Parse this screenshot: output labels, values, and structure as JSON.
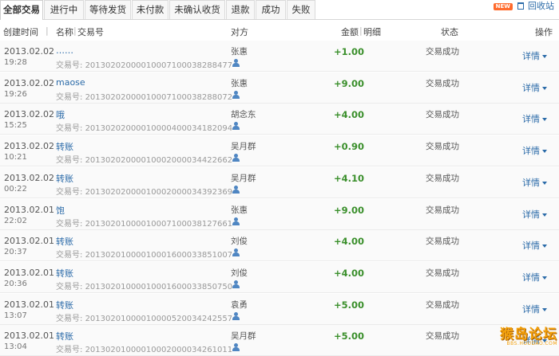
{
  "tabs": [
    {
      "label": "全部交易",
      "active": true
    },
    {
      "label": "进行中",
      "active": false
    },
    {
      "label": "等待发货",
      "active": false
    },
    {
      "label": "未付款",
      "active": false
    },
    {
      "label": "未确认收货",
      "active": false
    },
    {
      "label": "退款",
      "active": false
    },
    {
      "label": "成功",
      "active": false
    },
    {
      "label": "失败",
      "active": false
    }
  ],
  "recycle": {
    "badge": "NEW",
    "label": "回收站",
    "icon": "trash-icon"
  },
  "header": {
    "created": "创建时间",
    "name": "名称",
    "txid": "交易号",
    "party": "对方",
    "amount": "金额",
    "detail_col": "明细",
    "status": "状态",
    "action": "操作"
  },
  "txid_prefix": "交易号:",
  "rows": [
    {
      "date": "2013.02.02",
      "time": "19:28",
      "name": "……",
      "txid": "20130202000010007100038288477",
      "party": "张惠",
      "amount": "+1.00",
      "status": "交易成功",
      "detail": "详情"
    },
    {
      "date": "2013.02.02",
      "time": "19:26",
      "name": "maose",
      "txid": "20130202000010007100038288072",
      "party": "张惠",
      "amount": "+9.00",
      "status": "交易成功",
      "detail": "详情"
    },
    {
      "date": "2013.02.02",
      "time": "15:25",
      "name": "哦",
      "txid": "20130202000010000400034182094",
      "party": "胡念东",
      "amount": "+4.00",
      "status": "交易成功",
      "detail": "详情"
    },
    {
      "date": "2013.02.02",
      "time": "10:21",
      "name": "转账",
      "txid": "20130202000010002000034422662",
      "party": "吴月群",
      "amount": "+0.90",
      "status": "交易成功",
      "detail": "详情"
    },
    {
      "date": "2013.02.02",
      "time": "00:22",
      "name": "转账",
      "txid": "20130202000010002000034392369",
      "party": "吴月群",
      "amount": "+4.10",
      "status": "交易成功",
      "detail": "详情"
    },
    {
      "date": "2013.02.01",
      "time": "22:02",
      "name": "饱",
      "txid": "20130201000010007100038127661",
      "party": "张惠",
      "amount": "+9.00",
      "status": "交易成功",
      "detail": "详情"
    },
    {
      "date": "2013.02.01",
      "time": "20:37",
      "name": "转账",
      "txid": "20130201000010001600033851007",
      "party": "刘俊",
      "amount": "+4.00",
      "status": "交易成功",
      "detail": "详情"
    },
    {
      "date": "2013.02.01",
      "time": "20:36",
      "name": "转账",
      "txid": "20130201000010001600033850750",
      "party": "刘俊",
      "amount": "+4.00",
      "status": "交易成功",
      "detail": "详情"
    },
    {
      "date": "2013.02.01",
      "time": "13:07",
      "name": "转账",
      "txid": "20130201000010000520034242557",
      "party": "袁勇",
      "amount": "+5.00",
      "status": "交易成功",
      "detail": "详情"
    },
    {
      "date": "2013.02.01",
      "time": "13:04",
      "name": "转账",
      "txid": "20130201000010002000034261011",
      "party": "吴月群",
      "amount": "+5.00",
      "status": "交易成功",
      "detail": "详情"
    }
  ],
  "watermark": {
    "main": "猴岛论坛",
    "sub": "BBS.HOUDAO.COM"
  }
}
